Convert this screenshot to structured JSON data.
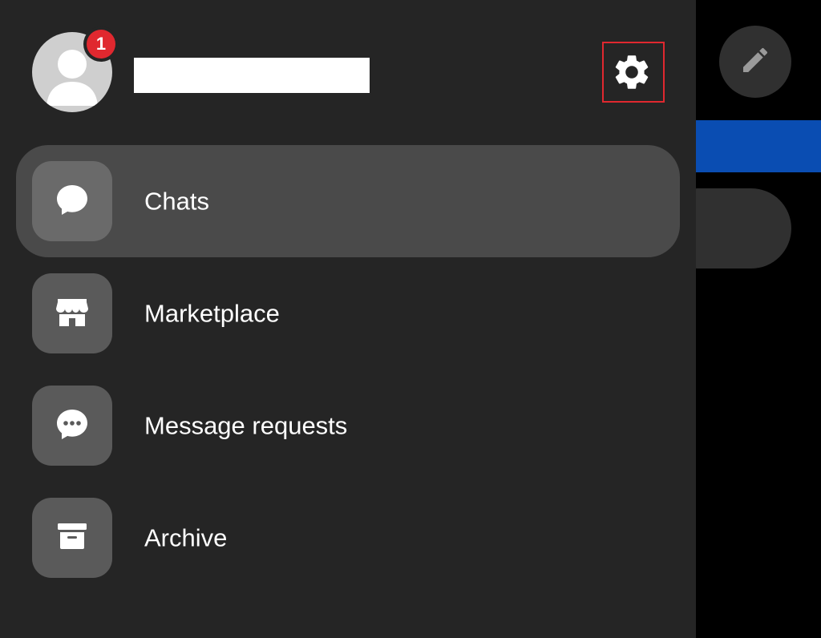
{
  "header": {
    "notification_count": "1",
    "name_redacted": ""
  },
  "menu": {
    "items": [
      {
        "label": "Chats",
        "icon": "chat-bubble-icon",
        "active": true
      },
      {
        "label": "Marketplace",
        "icon": "storefront-icon",
        "active": false
      },
      {
        "label": "Message requests",
        "icon": "message-requests-icon",
        "active": false
      },
      {
        "label": "Archive",
        "icon": "archive-box-icon",
        "active": false
      }
    ]
  },
  "colors": {
    "drawer_bg": "#252525",
    "active_item_bg": "#4a4a4a",
    "icon_box_bg": "#5a5a5a",
    "badge_red": "#e0282f",
    "highlight_red": "#e0282f",
    "brand_blue": "#0a4db2"
  },
  "icons": {
    "settings": "gear-icon",
    "compose": "pencil-icon",
    "avatar": "user-avatar-icon"
  }
}
